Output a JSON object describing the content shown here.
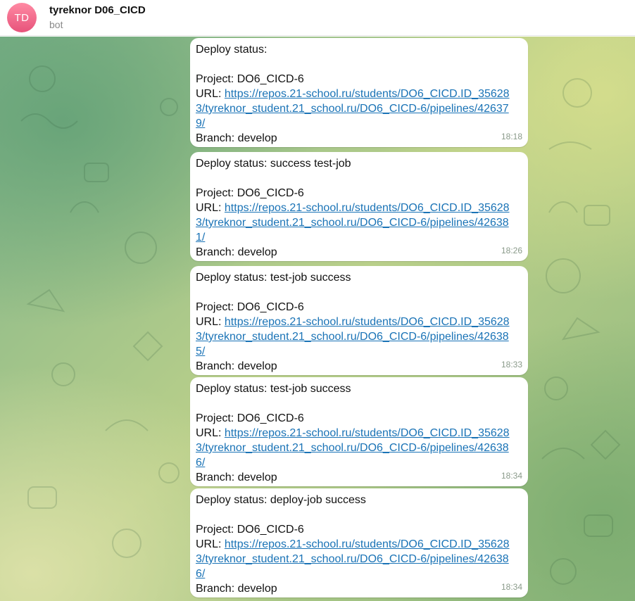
{
  "header": {
    "avatar_initials": "TD",
    "title": "tyreknor D06_CICD",
    "subtitle": "bot"
  },
  "messages": [
    {
      "status": "Deploy status:",
      "project": "Project: DO6_CICD-6",
      "url_prefix": "URL: ",
      "url": "https://repos.21-school.ru/students/DO6_CICD.ID_356283/tyreknor_student.21_school.ru/DO6_CICD-6/pipelines/426379/",
      "branch": "Branch: develop",
      "time": "18:18"
    },
    {
      "status": "Deploy status: success test-job",
      "project": "Project: DO6_CICD-6",
      "url_prefix": "URL: ",
      "url": "https://repos.21-school.ru/students/DO6_CICD.ID_356283/tyreknor_student.21_school.ru/DO6_CICD-6/pipelines/426381/",
      "branch": "Branch: develop",
      "time": "18:26"
    },
    {
      "status": "Deploy status: test-job success",
      "project": "Project: DO6_CICD-6",
      "url_prefix": "URL: ",
      "url": "https://repos.21-school.ru/students/DO6_CICD.ID_356283/tyreknor_student.21_school.ru/DO6_CICD-6/pipelines/426385/",
      "branch": "Branch: develop",
      "time": "18:33"
    },
    {
      "status": "Deploy status: test-job success",
      "project": "Project: DO6_CICD-6",
      "url_prefix": "URL: ",
      "url": "https://repos.21-school.ru/students/DO6_CICD.ID_356283/tyreknor_student.21_school.ru/DO6_CICD-6/pipelines/426386/",
      "branch": "Branch: develop",
      "time": "18:34"
    },
    {
      "status": "Deploy status: deploy-job success",
      "project": "Project: DO6_CICD-6",
      "url_prefix": "URL: ",
      "url": "https://repos.21-school.ru/students/DO6_CICD.ID_356283/tyreknor_student.21_school.ru/DO6_CICD-6/pipelines/426386/",
      "branch": "Branch: develop",
      "time": "18:34"
    }
  ]
}
